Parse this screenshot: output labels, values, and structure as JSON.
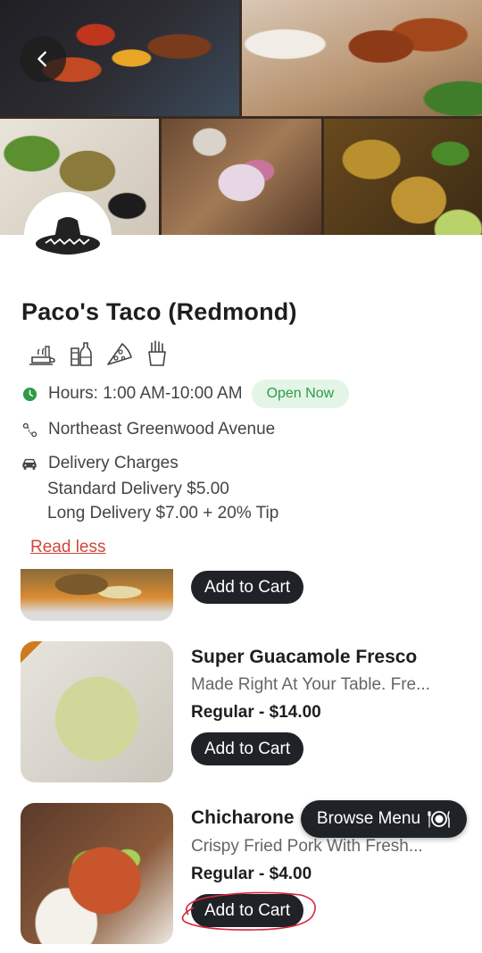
{
  "restaurant": {
    "name": "Paco's Taco (Redmond)",
    "hours": "Hours: 1:00 AM-10:00 AM",
    "status": "Open Now",
    "address": "Northeast Greenwood Avenue",
    "delivery_title": "Delivery Charges",
    "delivery_standard": "Standard Delivery $5.00",
    "delivery_long": "Long Delivery $7.00 + 20% Tip",
    "read_less": "Read less",
    "cuisine_icons": [
      "meal-icon",
      "drinks-icon",
      "pizza-icon",
      "fries-icon"
    ]
  },
  "menu": {
    "items": [
      {
        "add_label": "Add to Cart"
      },
      {
        "name": "Super Guacamole Fresco",
        "description": "Made Right At Your Table. Fre...",
        "price": "Regular - $14.00",
        "add_label": "Add to Cart"
      },
      {
        "name": "Chicharone",
        "description": "Crispy Fried Pork With Fresh...",
        "price": "Regular - $4.00",
        "add_label": "Add to Cart"
      }
    ],
    "browse_label": "Browse Menu"
  },
  "colors": {
    "accent_green": "#2e9b47",
    "read_less_red": "#d1453b",
    "button_dark": "#1f2327"
  }
}
